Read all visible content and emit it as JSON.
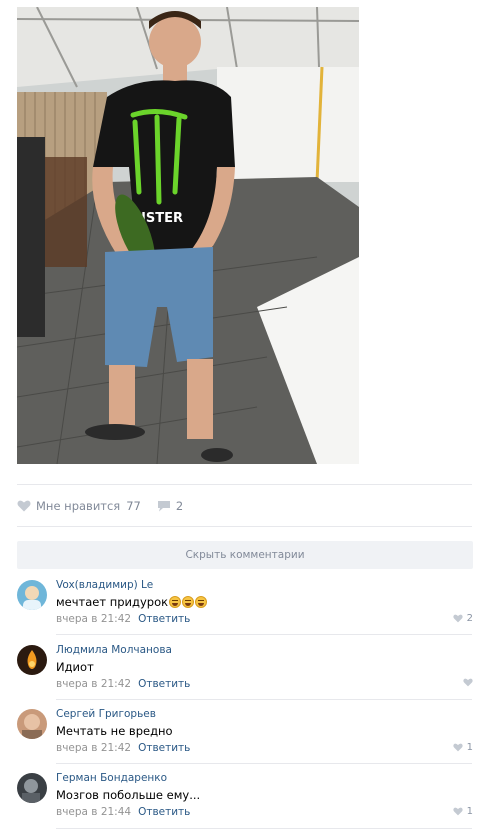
{
  "post": {
    "photo_alt": "Photo",
    "likes_label": "Мне нравится",
    "likes_count": "77",
    "comments_count": "2"
  },
  "hide_comments_label": "Скрыть комментарии",
  "comments": [
    {
      "author": "Vox(владимир) Le",
      "text": "мечтает придурок",
      "emoji_count": 3,
      "time": "вчера в 21:42",
      "reply": "Ответить",
      "likes": "2",
      "avatar_color": "#6fb6d9"
    },
    {
      "author": "Людмила Молчанова",
      "text": "Идиот",
      "time": "вчера в 21:42",
      "reply": "Ответить",
      "likes": "",
      "avatar_color": "#2b1a10"
    },
    {
      "author": "Сергей Григорьев",
      "text": "Мечтать не вредно",
      "time": "вчера в 21:42",
      "reply": "Ответить",
      "likes": "1",
      "avatar_color": "#c99a7a"
    },
    {
      "author": "Герман Бондаренко",
      "text": "Мозгов побольше ему...",
      "time": "вчера в 21:44",
      "reply": "Ответить",
      "likes": "1",
      "avatar_color": "#3a3f44"
    }
  ],
  "colors": {
    "link": "#2a5885",
    "meta": "#939393",
    "separator": "#e7e8ec",
    "bar": "#f0f2f5"
  }
}
